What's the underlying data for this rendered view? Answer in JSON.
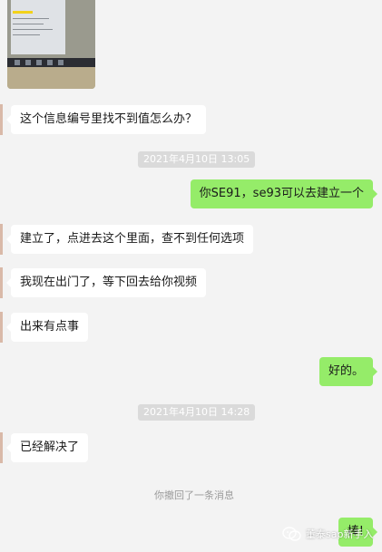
{
  "messages": [
    {
      "side": "left",
      "text": "这个信息编号里找不到值怎么办？"
    },
    {
      "timestamp": "2021年4月10日 13:05"
    },
    {
      "side": "right",
      "text": "你SE91，se93可以去建立一个"
    },
    {
      "side": "left",
      "text": "建立了，点进去这个里面，查不到任何选项"
    },
    {
      "side": "left",
      "text": "我现在出门了，等下回去给你视频"
    },
    {
      "side": "left",
      "text": "出来有点事"
    },
    {
      "side": "right",
      "text": "好的。"
    },
    {
      "timestamp": "2021年4月10日 14:28"
    },
    {
      "side": "left",
      "text": "已经解决了"
    },
    {
      "system": "你撤回了一条消息"
    },
    {
      "side": "right",
      "text": "棒!"
    }
  ],
  "watermark": {
    "text": "董泰sap新手入"
  },
  "icons": {
    "watermark": "wechat-official-account-icon"
  }
}
